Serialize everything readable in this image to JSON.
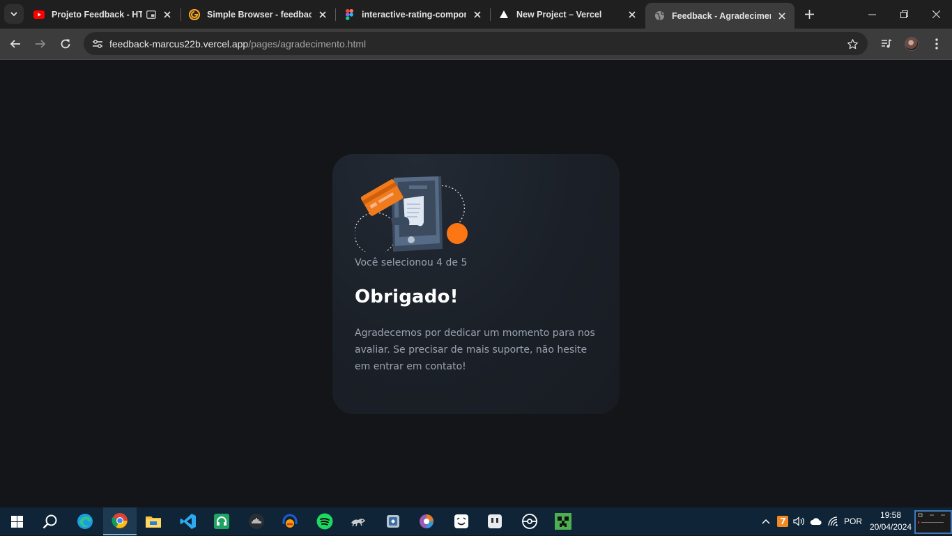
{
  "browser": {
    "tabs": [
      {
        "title": "Projeto Feedback - HTML",
        "favicon": "youtube-icon",
        "active": false
      },
      {
        "title": "Simple Browser - feedback",
        "favicon": "vscode-simple-browser-icon",
        "active": false
      },
      {
        "title": "interactive-rating-component",
        "favicon": "figma-icon",
        "active": false
      },
      {
        "title": "New Project – Vercel",
        "favicon": "vercel-icon",
        "active": false
      },
      {
        "title": "Feedback - Agradecimento",
        "favicon": "globe-icon",
        "active": true
      }
    ],
    "url": {
      "host": "feedback-marcus22b.vercel.app",
      "path": "/pages/agradecimento.html"
    }
  },
  "card": {
    "selected_text": "Você selecionou 4 de 5",
    "title": "Obrigado!",
    "body": "Agradecemos por dedicar um momento para nos avaliar. Se precisar de mais suporte, não hesite em entrar em contato!"
  },
  "taskbar": {
    "apps": [
      "windows-start",
      "search",
      "edge",
      "chrome",
      "file-explorer",
      "vscode",
      "headset-app",
      "soundcloud",
      "audio-app",
      "spotify",
      "gecko-app",
      "app-store",
      "paint-app",
      "kaomoji-app",
      "bot-app",
      "pokeball-app",
      "minecraft"
    ],
    "tray": {
      "language": "POR",
      "time": "19:58",
      "date": "20/04/2024"
    }
  },
  "colors": {
    "accent": "#fc7614",
    "card_bg": "#1f242d",
    "page_bg": "#131518",
    "muted_text": "#9aa3b0"
  }
}
